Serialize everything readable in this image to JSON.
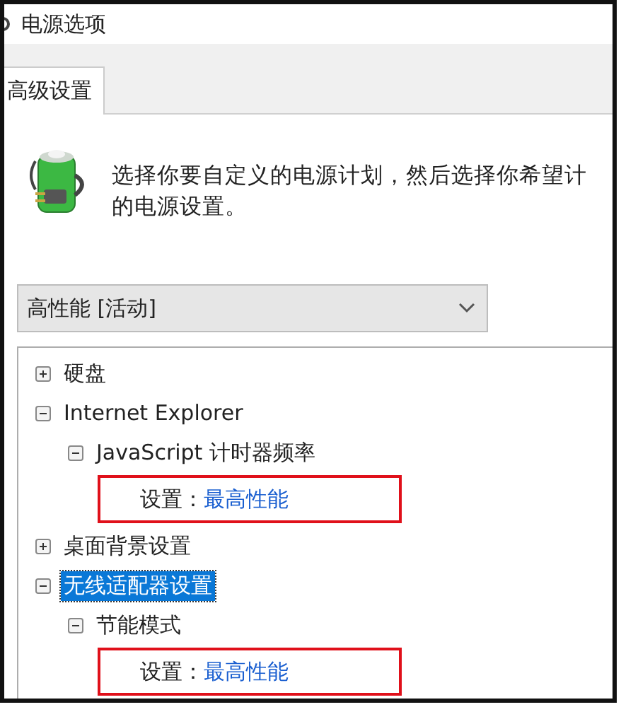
{
  "window": {
    "title": "电源选项"
  },
  "tabs": [
    {
      "label": "高级设置",
      "selected": true
    }
  ],
  "description": [
    "选择你要自定义的电源计划，然后选择你希望计",
    "的电源设置。"
  ],
  "plan_dropdown": {
    "value": "高性能 [活动]"
  },
  "tree": [
    {
      "kind": "node",
      "label": "硬盘",
      "expanded": false,
      "selected": false
    },
    {
      "kind": "node",
      "label": "Internet Explorer",
      "expanded": true,
      "selected": false,
      "children": [
        {
          "kind": "node",
          "label": "JavaScript 计时器频率",
          "expanded": true,
          "selected": false,
          "children": [
            {
              "kind": "setting",
              "label": "设置：",
              "value": "最高性能",
              "highlighted": true
            }
          ]
        }
      ]
    },
    {
      "kind": "node",
      "label": "桌面背景设置",
      "expanded": false,
      "selected": false
    },
    {
      "kind": "node",
      "label": "无线适配器设置",
      "expanded": true,
      "selected": true,
      "children": [
        {
          "kind": "node",
          "label": "节能模式",
          "expanded": true,
          "selected": false,
          "children": [
            {
              "kind": "setting",
              "label": "设置：",
              "value": "最高性能",
              "highlighted": true
            }
          ]
        }
      ]
    }
  ]
}
